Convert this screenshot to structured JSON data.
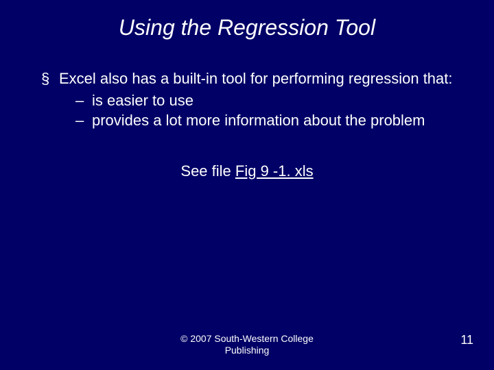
{
  "title": "Using the Regression Tool",
  "bullets": {
    "main": "Excel also has a built-in tool for performing regression that:",
    "sub1": "is easier to use",
    "sub2": "provides a lot more information about the problem"
  },
  "see_file": {
    "prefix": "See file ",
    "link_text": "Fig 9 -1. xls"
  },
  "footer": {
    "copyright": "© 2007 South-Western College Publishing",
    "page": "11"
  }
}
